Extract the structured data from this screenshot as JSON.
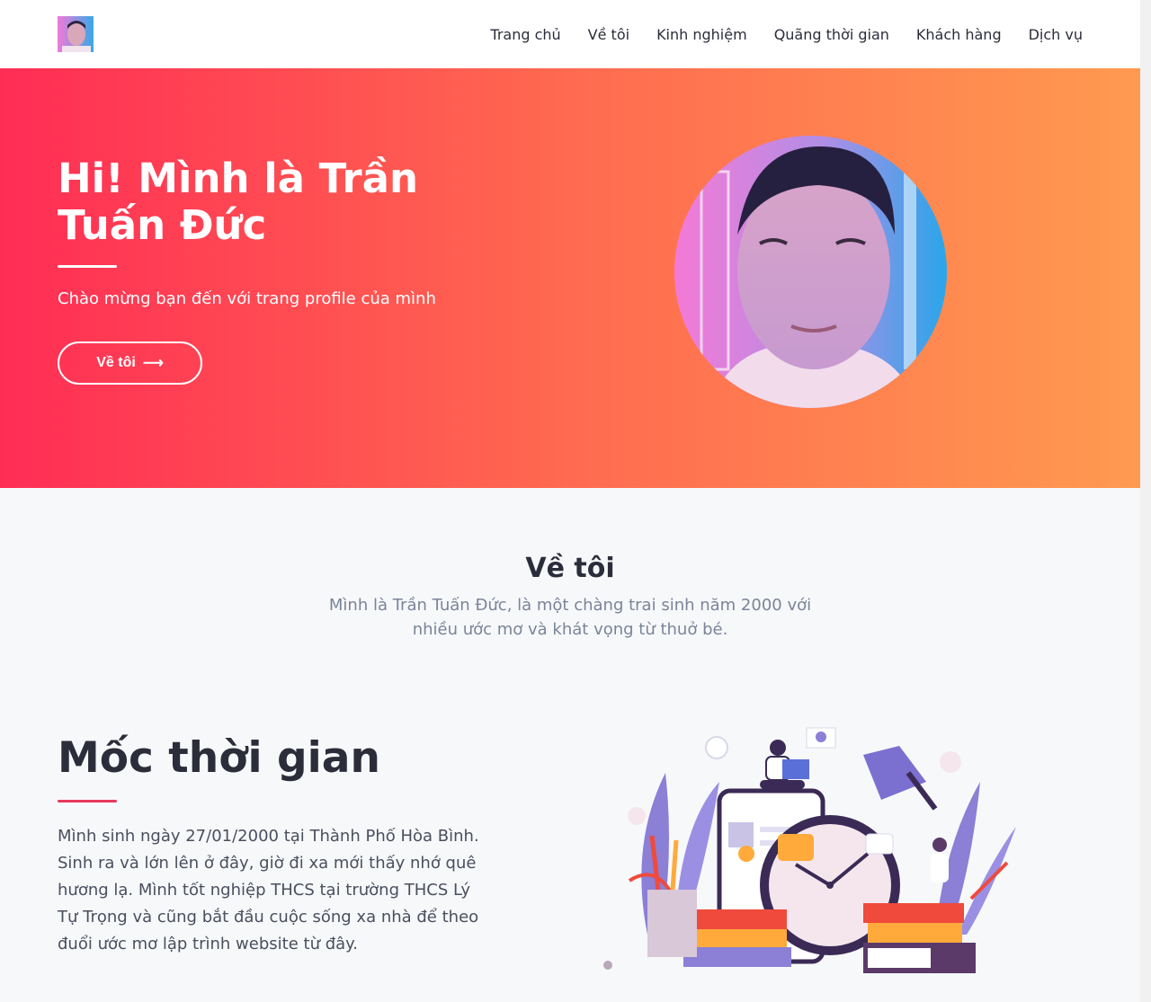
{
  "header": {
    "nav": [
      "Trang chủ",
      "Về tôi",
      "Kinh nghiệm",
      "Quãng thời gian",
      "Khách hàng",
      "Dịch vụ"
    ]
  },
  "hero": {
    "title": "Hi! Mình là Trần Tuấn Đức",
    "subtitle": "Chào mừng bạn đến với trang profile của mình",
    "button_label": "Về tôi",
    "button_arrow": "⟶"
  },
  "about": {
    "title": "Về tôi",
    "text": "Mình là Trần Tuấn Đức, là một chàng trai sinh năm 2000 với nhiều ước mơ và khát vọng từ thuở bé."
  },
  "timeline": {
    "title": "Mốc thời gian",
    "text": "Mình sinh ngày 27/01/2000 tại Thành Phố Hòa Bình. Sinh ra và lớn lên ở đây, giờ đi xa mới thấy nhớ quê hương lạ. Mình tốt nghiệp THCS tại trường THCS Lý Tự Trọng và cũng bắt đầu cuộc sống xa nhà để theo đuổi ước mơ lập trình website từ đây."
  },
  "colors": {
    "hero_start": "#ff2d55",
    "hero_end": "#ff9a50",
    "accent": "#e8385e",
    "illustration_purple": "#8b7fd6"
  }
}
